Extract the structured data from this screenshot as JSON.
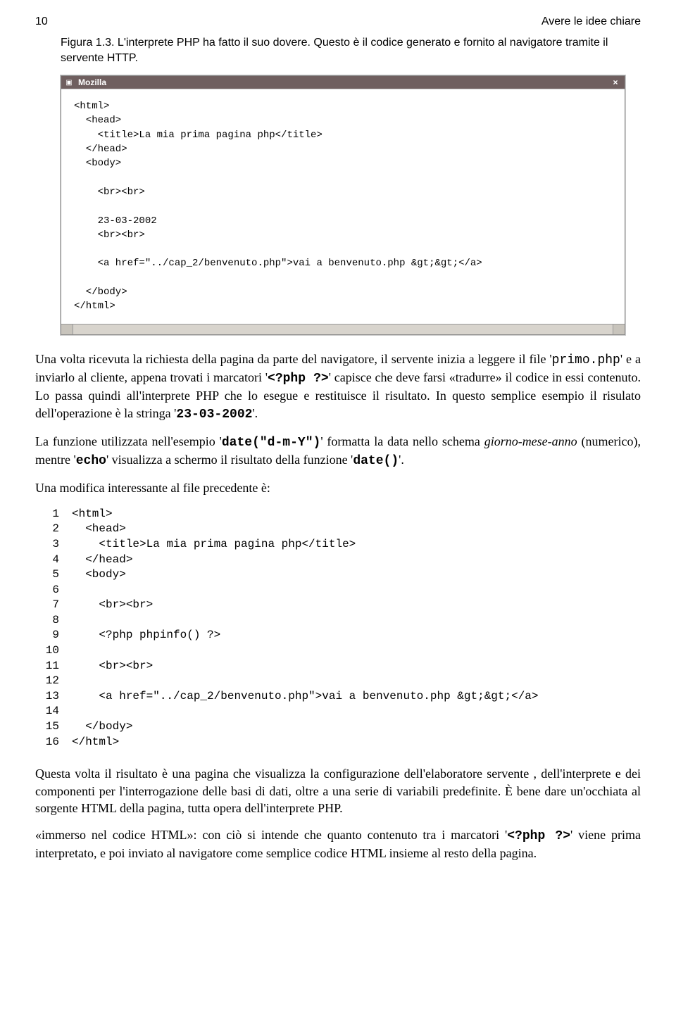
{
  "header": {
    "page_number": "10",
    "running_title": "Avere le idee chiare"
  },
  "caption": {
    "text": "Figura 1.3. L'interprete PHP ha fatto il suo dovere. Questo è il codice generato e fornito al navigatore tramite il servente HTTP."
  },
  "window": {
    "title": "Mozilla",
    "code_lines": [
      "<html>",
      "  <head>",
      "    <title>La mia prima pagina php</title>",
      "  </head>",
      "  <body>",
      "",
      "    <br><br>",
      "",
      "    23-03-2002",
      "    <br><br>",
      "",
      "    <a href=\"../cap_2/benvenuto.php\">vai a benvenuto.php &gt;&gt;</a>",
      "",
      "  </body>",
      "</html>"
    ]
  },
  "para1": {
    "pre1": "Una volta ricevuta la richiesta della pagina da parte del navigatore, il servente inizia a leggere il file '",
    "code1": "primo.php",
    "mid1": "' e a inviarlo al cliente, appena trovati i marcatori '",
    "code2": "<?php ?>",
    "mid2": "' capisce che deve farsi «tradurre» il codice in essi contenuto. Lo passa quindi all'interprete PHP che lo esegue e restituisce il risultato. In questo semplice esempio il risulato dell'operazione è la stringa '",
    "code3": "23-03-2002",
    "post": "'."
  },
  "para2": {
    "pre1": "La funzione utilizzata nell'esempio '",
    "code1": "date(\"d-m-Y\")",
    "mid1": "' formatta la data nello schema ",
    "italic": "giorno-mese-anno",
    "mid2": " (numerico), mentre '",
    "code2": "echo",
    "mid3": "' visualizza a schermo il risultato della funzione '",
    "code3": "date()",
    "post": "'."
  },
  "para3": "Una modifica interessante al file precedente è:",
  "code_listing": [
    {
      "n": "1",
      "t": "<html>"
    },
    {
      "n": "2",
      "t": "  <head>"
    },
    {
      "n": "3",
      "t": "    <title>La mia prima pagina php</title>"
    },
    {
      "n": "4",
      "t": "  </head>"
    },
    {
      "n": "5",
      "t": "  <body>"
    },
    {
      "n": "6",
      "t": ""
    },
    {
      "n": "7",
      "t": "    <br><br>"
    },
    {
      "n": "8",
      "t": ""
    },
    {
      "n": "9",
      "t": "    <?php phpinfo() ?>"
    },
    {
      "n": "10",
      "t": ""
    },
    {
      "n": "11",
      "t": "    <br><br>"
    },
    {
      "n": "12",
      "t": ""
    },
    {
      "n": "13",
      "t": "    <a href=\"../cap_2/benvenuto.php\">vai a benvenuto.php &gt;&gt;</a>"
    },
    {
      "n": "14",
      "t": ""
    },
    {
      "n": "15",
      "t": "  </body>"
    },
    {
      "n": "16",
      "t": "</html>"
    }
  ],
  "para4": "Questa volta il risultato è una pagina che visualizza la configurazione dell'elaboratore servente , dell'interprete e dei componenti per l'interrogazione delle basi di dati, oltre a una serie di variabili predefinite. È bene dare un'occhiata al sorgente HTML della pagina, tutta opera dell'interprete PHP.",
  "para5": {
    "pre": "«immerso nel codice HTML»: con ciò si intende che quanto contenuto tra i marcatori '",
    "code": "<?php ?>",
    "post": "' viene prima interpretato, e poi inviato al navigatore come semplice codice HTML insieme al resto della pagina."
  }
}
